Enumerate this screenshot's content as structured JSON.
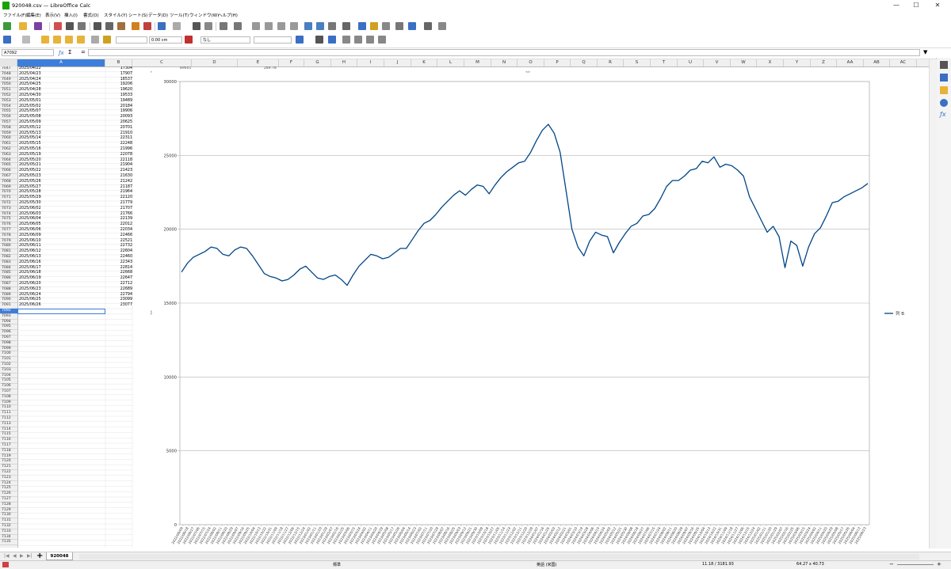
{
  "window": {
    "title": "920048.csv — LibreOffice Calc",
    "minimize": "—",
    "maximize": "☐",
    "close": "✕"
  },
  "menu": [
    "ファイル(F)",
    "編集(E)",
    "表示(V)",
    "挿入(I)",
    "書式(O)",
    "スタイル(Y)",
    "シート(S)",
    "データ(D)",
    "ツール(T)",
    "ウィンドウ(W)",
    "ヘルプ(H)"
  ],
  "toolbar2": {
    "line_width": "0.00 cm",
    "area_style": "なし"
  },
  "formula": {
    "name_box": "A7092",
    "fx": "ƒx",
    "sigma": "Σ",
    "equals": "=",
    "value": ""
  },
  "columns": [
    "A",
    "B",
    "C",
    "D",
    "E",
    "F",
    "G",
    "H",
    "I",
    "J",
    "K",
    "L",
    "M",
    "N",
    "O",
    "P",
    "Q",
    "R",
    "S",
    "T",
    "U",
    "V",
    "W",
    "X",
    "Y",
    "Z",
    "AA",
    "AB",
    "AC"
  ],
  "rows": {
    "numbers": [
      "7047",
      "7048",
      "7049",
      "7050",
      "7051",
      "7052",
      "7053",
      "7054",
      "7055",
      "7056",
      "7057",
      "7058",
      "7059",
      "7060",
      "7061",
      "7062",
      "7063",
      "7064",
      "7065",
      "7066",
      "7067",
      "7068",
      "7069",
      "7070",
      "7071",
      "7072",
      "7073",
      "7074",
      "7075",
      "7076",
      "7077",
      "7078",
      "7079",
      "7080",
      "7081",
      "7082",
      "7083",
      "7084",
      "7085",
      "7086",
      "7087",
      "7088",
      "7089",
      "7090",
      "7091",
      "7092",
      "7093",
      "7094",
      "7095",
      "7096",
      "7097",
      "7098",
      "7099",
      "7100",
      "7101",
      "7102",
      "7103",
      "7104",
      "7105",
      "7106",
      "7107",
      "7108",
      "7109",
      "7110",
      "7111",
      "7112",
      "7113",
      "7114",
      "7115",
      "7116",
      "7117",
      "7118",
      "7119",
      "7120",
      "7121",
      "7122",
      "7123",
      "7124",
      "7125",
      "7126",
      "7127",
      "7128",
      "7129",
      "7130",
      "7131",
      "7132",
      "7133",
      "7134",
      "7135"
    ],
    "dates": [
      "2025/04/22",
      "2025/04/23",
      "2025/04/24",
      "2025/04/25",
      "2025/04/28",
      "2025/04/30",
      "2025/05/01",
      "2025/05/02",
      "2025/05/07",
      "2025/05/08",
      "2025/05/09",
      "2025/05/12",
      "2025/05/13",
      "2025/05/14",
      "2025/05/15",
      "2025/05/16",
      "2025/05/19",
      "2025/05/20",
      "2025/05/21",
      "2025/05/22",
      "2025/05/23",
      "2025/05/26",
      "2025/05/27",
      "2025/05/28",
      "2025/05/29",
      "2025/05/30",
      "2025/06/02",
      "2025/06/03",
      "2025/06/04",
      "2025/06/05",
      "2025/06/06",
      "2025/06/09",
      "2025/06/10",
      "2025/06/11",
      "2025/06/12",
      "2025/06/13",
      "2025/06/16",
      "2025/06/17",
      "2025/06/18",
      "2025/06/19",
      "2025/06/20",
      "2025/06/23",
      "2025/06/24",
      "2025/06/25",
      "2025/06/26"
    ],
    "values": [
      "17304",
      "17907",
      "18537",
      "19206",
      "19620",
      "19533",
      "19489",
      "20184",
      "19906",
      "20093",
      "20625",
      "20701",
      "21910",
      "22311",
      "22248",
      "21996",
      "22078",
      "22118",
      "21904",
      "21423",
      "21630",
      "21242",
      "21187",
      "21964",
      "22120",
      "21779",
      "21707",
      "21766",
      "22139",
      "22012",
      "22034",
      "22466",
      "22521",
      "22732",
      "22604",
      "22460",
      "22343",
      "22814",
      "22668",
      "22647",
      "22712",
      "22689",
      "22794",
      "23099",
      "23077"
    ]
  },
  "partial_cells": {
    "c": "89601",
    "e": "289.78"
  },
  "sheet_tab": "920048",
  "status": {
    "mode": "標準",
    "lang": "英語 (米国)",
    "pos": "11.18 / 3181.93",
    "size": "64.27 x 40.73"
  },
  "chart_data": {
    "type": "line",
    "title": "",
    "xlabel": "",
    "ylabel": "",
    "ylim": [
      0,
      30000
    ],
    "yticks": [
      0,
      5000,
      10000,
      15000,
      20000,
      25000,
      30000
    ],
    "grid": true,
    "legend_position": "right",
    "series": [
      {
        "name": "列 B",
        "color": "#004586",
        "values": [
          17100,
          17700,
          18100,
          18300,
          18500,
          18800,
          18700,
          18300,
          18200,
          18600,
          18800,
          18700,
          18200,
          17600,
          17000,
          16800,
          16700,
          16500,
          16600,
          16900,
          17300,
          17500,
          17100,
          16700,
          16600,
          16800,
          16900,
          16600,
          16200,
          16900,
          17500,
          17900,
          18300,
          18200,
          18000,
          18100,
          18400,
          18700,
          18700,
          19300,
          19900,
          20400,
          20600,
          21000,
          21500,
          21900,
          22300,
          22600,
          22300,
          22700,
          23000,
          22900,
          22400,
          23000,
          23500,
          23900,
          24200,
          24500,
          24600,
          25200,
          26000,
          26700,
          27100,
          26500,
          25200,
          22600,
          20000,
          18800,
          18200,
          19200,
          19800,
          19600,
          19500,
          18400,
          19100,
          19700,
          20200,
          20400,
          20900,
          21000,
          21400,
          22100,
          22900,
          23300,
          23300,
          23600,
          24000,
          24100,
          24600,
          24500,
          24900,
          24200,
          24400,
          24300,
          24000,
          23600,
          22200,
          21400,
          20600,
          19800,
          20200,
          19500,
          17400,
          19200,
          18900,
          17500,
          18800,
          19700,
          20100,
          20900,
          21800,
          21900,
          22200,
          22400,
          22600,
          22800,
          23100
        ]
      }
    ],
    "categories_first": "2022/06/09",
    "categories_last": "2025/06/23"
  }
}
